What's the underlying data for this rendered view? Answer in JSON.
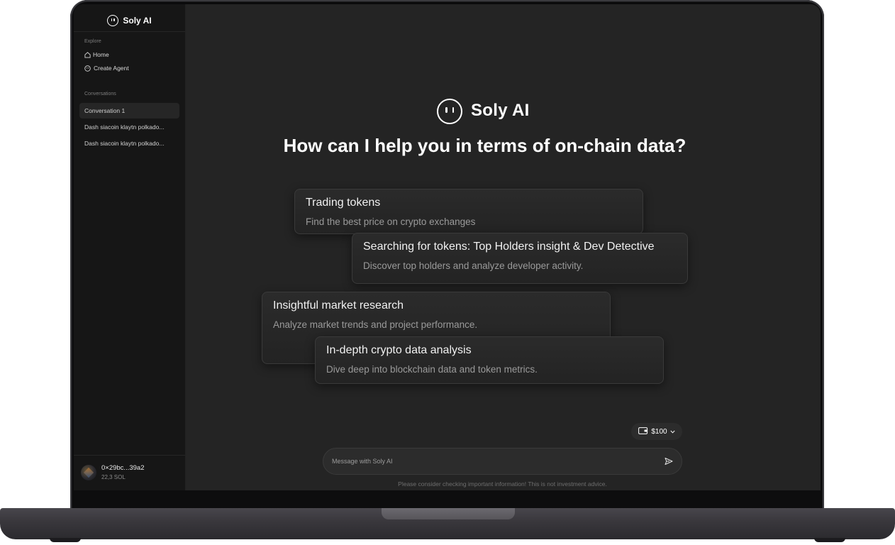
{
  "sidebar": {
    "brand": "Soly AI",
    "explore_label": "Explore",
    "nav": [
      {
        "label": "Home",
        "icon": "home-icon"
      },
      {
        "label": "Create Agent",
        "icon": "agent-icon"
      }
    ],
    "conversations_label": "Conversations",
    "conversations": [
      {
        "label": "Conversation 1",
        "active": true
      },
      {
        "label": "Dash siacoin klaytn polkado...",
        "active": false
      },
      {
        "label": "Dash siacoin klaytn polkado...",
        "active": false
      }
    ],
    "wallet": {
      "address": "0×29bc...39a2",
      "balance": "22,3 SOL"
    }
  },
  "main": {
    "brand": "Soly AI",
    "question": "How can I help you in terms of on-chain data?",
    "cards": [
      {
        "title": "Trading tokens",
        "desc": "Find the best price on crypto exchanges"
      },
      {
        "title": "Searching for tokens: Top Holders insight & Dev Detective",
        "desc": "Discover top holders and analyze developer activity."
      },
      {
        "title": "Insightful market research",
        "desc": "Analyze market trends and project performance."
      },
      {
        "title": "In-depth crypto data analysis",
        "desc": "Dive deep into blockchain data and token metrics."
      }
    ],
    "budget": "$100",
    "input_placeholder": "Message with Soly AI",
    "disclaimer": "Please consider checking important information! This is not investment advice."
  },
  "colors": {
    "background": "#242424",
    "sidebar": "#161616",
    "card": "#2b2b2b",
    "text": "#ffffff"
  }
}
